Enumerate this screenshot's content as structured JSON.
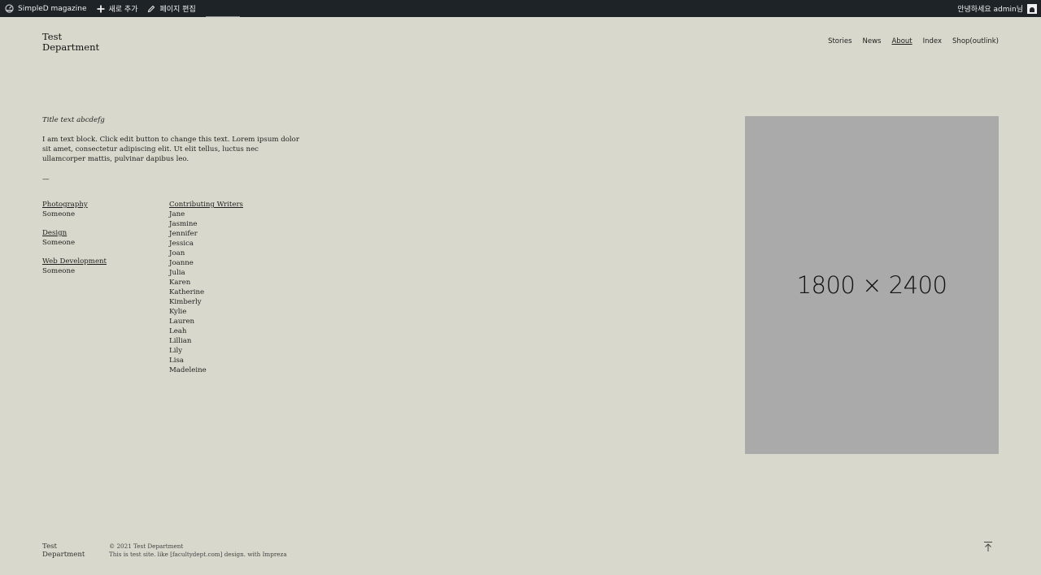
{
  "adminbar": {
    "site_name": "SimpleD magazine",
    "new_label": "새로 추가",
    "edit_label": "페이지 편집",
    "greeting": "안녕하세요 admin님"
  },
  "site": {
    "logo_line1": "Test",
    "logo_line2": "Department"
  },
  "nav": {
    "stories": "Stories",
    "news": "News",
    "about": "About",
    "index": "Index",
    "shop": "Shop(outlink)"
  },
  "content": {
    "title": "Title text abcdefg",
    "text": "I am text block. Click edit button to change this text. Lorem ipsum dolor sit amet, consectetur adipiscing elit. Ut elit tellus, luctus nec ullamcorper mattis, pulvinar dapibus leo.",
    "divider": "—"
  },
  "credits": {
    "photography_label": "Photography",
    "photography_value": "Someone",
    "design_label": "Design",
    "design_value": "Someone",
    "webdev_label": "Web Development",
    "webdev_value": "Someone",
    "writers_label": "Contributing Writers",
    "writers": [
      "Jane",
      "Jasmine",
      "Jennifer",
      "Jessica",
      "Joan",
      "Joanne",
      "Julia",
      "Karen",
      "Katherine",
      "Kimberly",
      "Kylie",
      "Lauren",
      "Leah",
      "Lillian",
      "Lily",
      "Lisa",
      "Madeleine"
    ]
  },
  "image": {
    "placeholder_text": "1800 × 2400"
  },
  "footer": {
    "logo_line1": "Test",
    "logo_line2": "Department",
    "copyright": "© 2021 Test Department",
    "note": "This is test site. like [facultydept.com] design. with Impreza"
  }
}
